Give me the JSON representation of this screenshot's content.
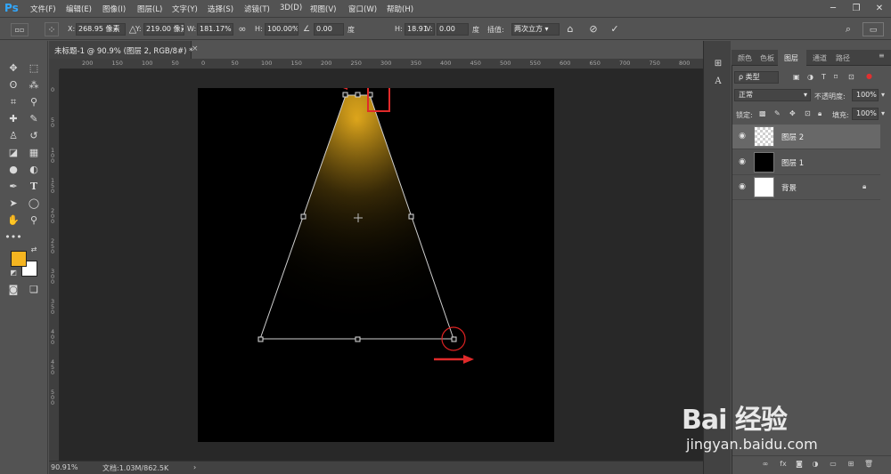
{
  "app": {
    "logo": "Ps",
    "menu": [
      "文件(F)",
      "编辑(E)",
      "图像(I)",
      "图层(L)",
      "文字(Y)",
      "选择(S)",
      "滤镜(T)",
      "3D(D)",
      "视图(V)",
      "窗口(W)",
      "帮助(H)"
    ],
    "window_buttons": [
      "minimize-icon",
      "restore-icon",
      "close-icon"
    ]
  },
  "options": {
    "x_label": "X:",
    "x_value": "268.95 像素",
    "y_label": "Y:",
    "y_value": "219.00 像素",
    "w_label": "W:",
    "w_value": "181.17%",
    "h_label": "H:",
    "h_value": "100.00%",
    "angle_value": "0.00",
    "angle_unit": "度",
    "hskew_label": "H:",
    "hskew_value": "18.91",
    "hskew_unit": "度",
    "vskew_label": "V:",
    "vskew_value": "0.00",
    "vskew_unit": "度",
    "interp_label": "插值:",
    "interp_value": "两次立方"
  },
  "document": {
    "tab_title": "未标题-1 @ 90.9% (图层 2, RGB/8#) *",
    "ruler_h": [
      "200",
      "150",
      "100",
      "50",
      "0",
      "50",
      "100",
      "150",
      "200",
      "250",
      "300",
      "350",
      "400",
      "450",
      "500",
      "550",
      "600",
      "650",
      "700",
      "750",
      "800"
    ],
    "ruler_v": [
      "0",
      "5 0",
      "1 0 0",
      "1 5 0",
      "2 0 0",
      "2 5 0",
      "3 0 0",
      "3 5 0",
      "4 0 0",
      "4 5 0",
      "5 0 0"
    ],
    "zoom": "90.91%",
    "doc_info": "文档:1.03M/862.5K",
    "light_color": "#f2b51e"
  },
  "tools": {
    "foreground_color": "#f5b520",
    "background_color": "#ffffff"
  },
  "panel": {
    "tabs": [
      "颜色",
      "色板",
      "图层",
      "通道",
      "路径"
    ],
    "active_tab": "图层",
    "filter_placeholder": "ρ 类型",
    "blend_mode": "正常",
    "opacity_label": "不透明度:",
    "opacity_value": "100%",
    "lock_label": "锁定:",
    "fill_label": "填充:",
    "fill_value": "100%",
    "layers": [
      {
        "name": "图层 2",
        "selected": true,
        "thumb": "transparent"
      },
      {
        "name": "图层 1",
        "selected": false,
        "thumb": "black"
      },
      {
        "name": "背景",
        "selected": false,
        "thumb": "white",
        "locked": true
      }
    ]
  },
  "watermark": {
    "brand": "Bai 经验",
    "url": "jingyan.baidu.com"
  }
}
